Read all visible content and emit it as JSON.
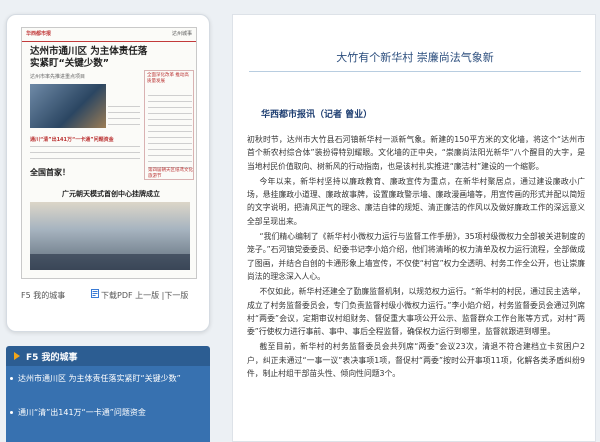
{
  "thumbnail": {
    "masthead": "华西都市报",
    "edition": "达州城事",
    "headline": "达州市通川区 为主体责任落实紧盯“关键少数”",
    "side_col_title": "全面深化改革 推动高质量发展",
    "headline2": "达州市率先推进重点项目",
    "subline": "通川“清”出141万“一卡通”问题资金",
    "headline3": "全国首家！",
    "headline4": "广元朝天模式首创中心挂牌成立",
    "side_col2_title": "第四届朝天区纸鸢文化旅游节",
    "footer_f5": "F5 我的城事",
    "footer_download": "下载PDF 上一版 |下一版"
  },
  "nav": {
    "header": "F5  我的城事",
    "items": [
      "达州市通川区 为主体责任落实紧盯“关键少数”",
      "通川“清”出141万“一卡通”问题资金"
    ]
  },
  "article": {
    "title": "大竹有个新华村 崇廉尚法气象新",
    "byline": "华西都市报讯（记者 曾业）",
    "paragraphs": [
      "初秋时节，达州市大竹县石河镇新华村一派新气象。新建的150平方米的文化墙，将这个“达州市首个新农村综合体”装扮得特别耀眼。文化墙的正中央，“崇廉尚法阳光新华”八个醒目的大字，是当地村民价值取向、树新风的行动指南，也是该村扎实推进“廉洁村”建设的一个缩影。",
      "今年以来，新华村坚持以廉政教育、廉政宣传为重点，在新华村聚居点，通过建设廉政小广场，悬挂廉政小道理、廉政故事牌，设置廉政警示墙、廉政漫画墙等，用宣传画的形式并配以简短的文字说明，把清风正气的理念、廉洁自律的规矩、清正廉洁的作风以及做好廉政工作的深远意义全部呈现出来。",
      "“我们精心编制了《新华村小微权力运行与监督工作手册》，35项村级微权力全部被关进制度的笼子。”石河镇党委委员、纪委书记李小焰介绍，他们将清晰的权力清单及权力运行流程，全部做成了图画，并结合自创的卡通形象上墙宣传，不仅使“村官”权力全透明、村务工作全公开，也让崇廉尚法的理念深入人心。",
      "不仅如此，新华村还建全了勤廉监督机制，以规范权力运行。“新华村的村民，通过民主选举，成立了村务监督委员会，专门负责监督村级小微权力运行。”李小焰介绍，村务监督委员会通过列席村“两委”会议，定期审议村组财务、督促重大事项公开公示、监督群众工作台账等方式，对村“两委”行使权力进行事前、事中、事后全程监督，确保权力运行到哪里，监督就跟进到哪里。",
      "截至目前，新华村的村务监督委员会共列席“两委”会议23次，清退不符合建档立卡贫困户2户，纠正未通过“一事一议”表决事项1项，督促村“两委”按时公开事项11项，化解各类矛盾纠纷9件，制止村组干部苗头性、倾向性问题3个。"
    ]
  }
}
